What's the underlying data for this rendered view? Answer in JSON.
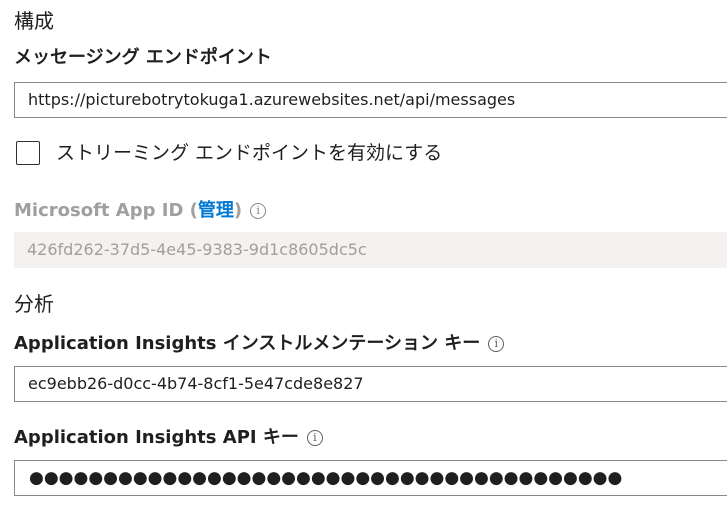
{
  "configuration": {
    "heading": "構成",
    "messaging_endpoint": {
      "label": "メッセージング エンドポイント",
      "value": "https://picturebotrytokuga1.azurewebsites.net/api/messages"
    },
    "streaming_endpoint": {
      "label": "ストリーミング エンドポイントを有効にする",
      "checked": false
    },
    "app_id": {
      "label_prefix": "Microsoft App ID (",
      "manage_link": "管理",
      "label_suffix": ")",
      "info_icon": "info-icon",
      "value": "426fd262-37d5-4e45-9383-9d1c8605dc5c"
    }
  },
  "analytics": {
    "heading": "分析",
    "instrumentation_key": {
      "label": "Application Insights インストルメンテーション キー",
      "info_icon": "info-icon",
      "value": "ec9ebb26-d0cc-4b74-8cf1-5e47cde8e827"
    },
    "api_key": {
      "label": "Application Insights API キー",
      "info_icon": "info-icon",
      "value": "●●●●●●●●●●●●●●●●●●●●●●●●●●●●●●●●●●●●●●●●"
    }
  },
  "colors": {
    "link": "#0078d4",
    "disabled_text": "#a19f9d",
    "readonly_bg": "#f3f2f1",
    "input_border": "#8a8886"
  }
}
